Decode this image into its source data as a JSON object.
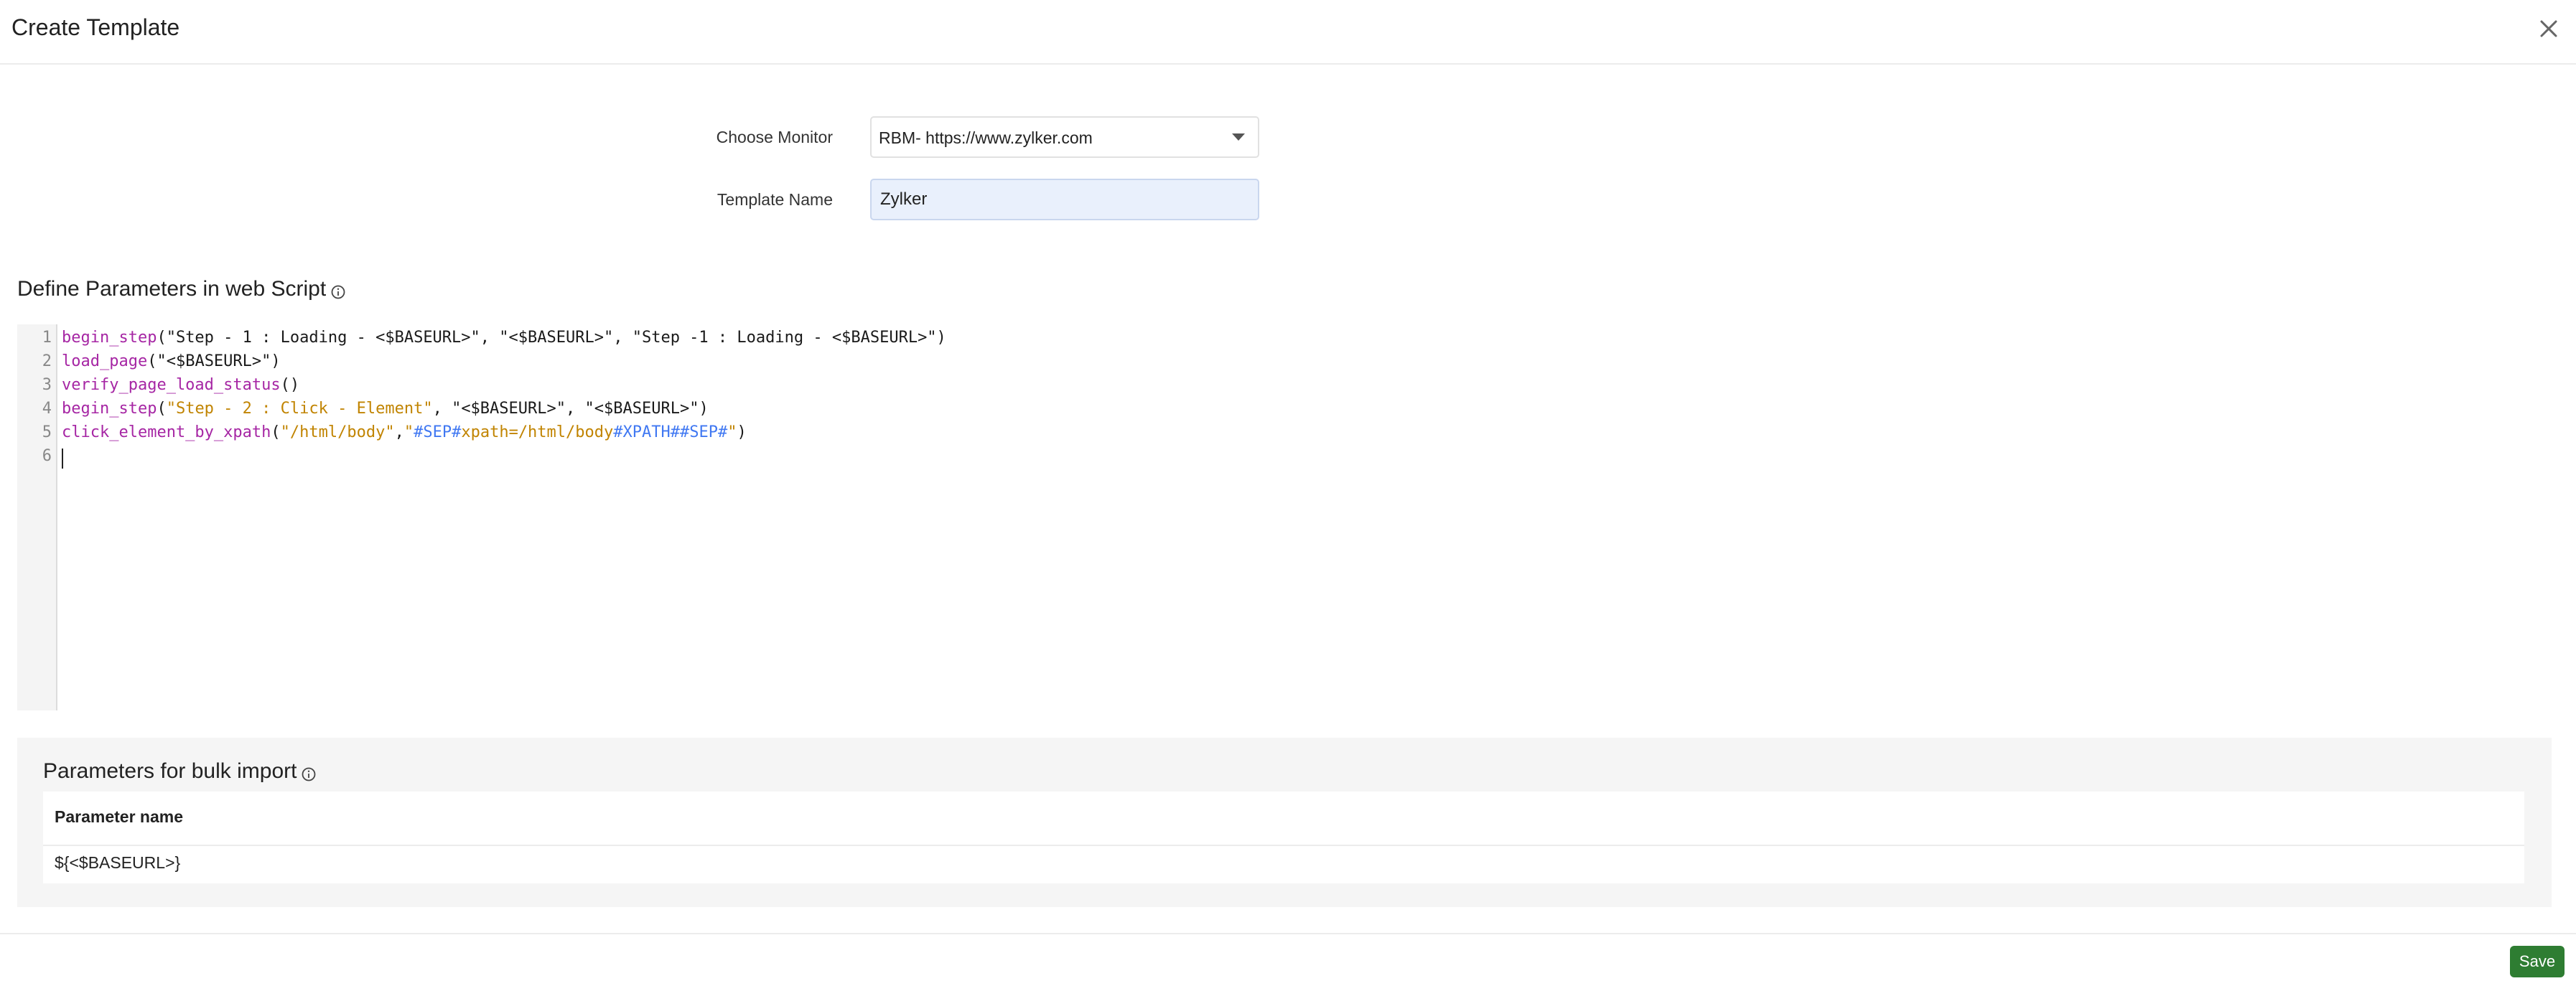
{
  "header": {
    "title": "Create Template",
    "close_icon": "close-icon"
  },
  "form": {
    "monitor_label": "Choose Monitor",
    "monitor_value": "RBM- https://www.zylker.com",
    "template_name_label": "Template Name",
    "template_name_value": "Zylker"
  },
  "script_section": {
    "title": "Define Parameters in web Script",
    "info_icon": "info-icon",
    "line_numbers": [
      "1",
      "2",
      "3",
      "4",
      "5",
      "6"
    ],
    "lines": [
      [
        {
          "t": "begin_step",
          "c": "fn"
        },
        {
          "t": "(\"Step - 1 : Loading - <$BASEURL>\", \"<$BASEURL>\", \"Step -1 : Loading - <$BASEURL>\")",
          "c": "plain"
        }
      ],
      [
        {
          "t": "load_page",
          "c": "fn"
        },
        {
          "t": "(\"<$BASEURL>\")",
          "c": "plain"
        }
      ],
      [
        {
          "t": "verify_page_load_status",
          "c": "fn"
        },
        {
          "t": "()",
          "c": "plain"
        }
      ],
      [
        {
          "t": "begin_step",
          "c": "fn"
        },
        {
          "t": "(",
          "c": "plain"
        },
        {
          "t": "\"Step - 2 : Click - Element\"",
          "c": "str"
        },
        {
          "t": ", \"<$BASEURL>\", \"<$BASEURL>\")",
          "c": "plain"
        }
      ],
      [
        {
          "t": "click_element_by_xpath",
          "c": "fn"
        },
        {
          "t": "(",
          "c": "plain"
        },
        {
          "t": "\"/html/body\"",
          "c": "str"
        },
        {
          "t": ",",
          "c": "plain"
        },
        {
          "t": "\"",
          "c": "str"
        },
        {
          "t": "#SEP#",
          "c": "var"
        },
        {
          "t": "xpath=/html/body",
          "c": "str"
        },
        {
          "t": "#XPATH##SEP#",
          "c": "var"
        },
        {
          "t": "\"",
          "c": "str"
        },
        {
          "t": ")",
          "c": "plain"
        }
      ],
      []
    ]
  },
  "bulk_import": {
    "title": "Parameters for bulk import",
    "info_icon": "info-icon",
    "column_header": "Parameter name",
    "rows": [
      "${<$BASEURL>}"
    ]
  },
  "footer": {
    "save_label": "Save"
  },
  "colors": {
    "function": "#a626a4",
    "string": "#c18401",
    "variable": "#4078f2",
    "save_button": "#2e7d32",
    "input_background": "#e9f0fc"
  }
}
